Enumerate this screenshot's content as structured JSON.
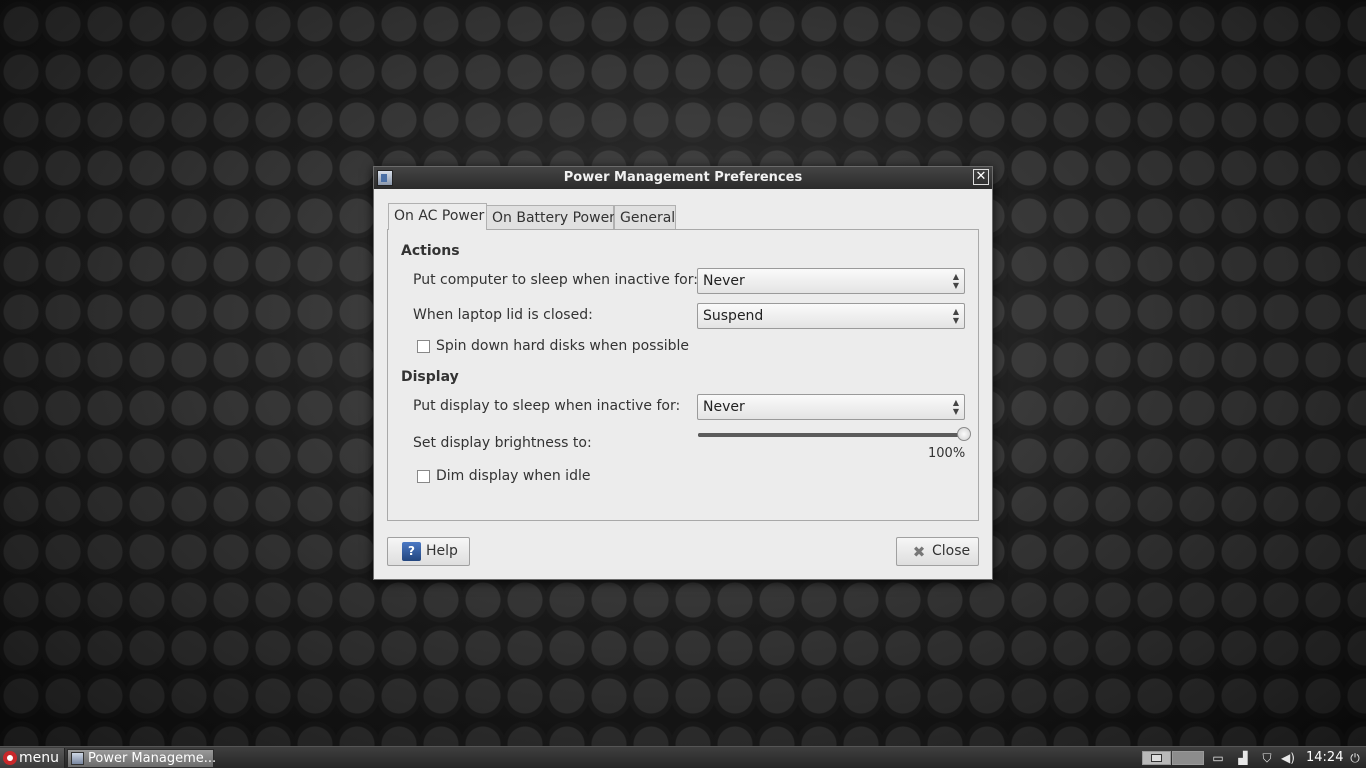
{
  "window": {
    "title": "Power Management Preferences"
  },
  "tabs": [
    {
      "label": "On AC Power",
      "active": true
    },
    {
      "label": "On Battery Power",
      "active": false
    },
    {
      "label": "General",
      "active": false
    }
  ],
  "actions": {
    "heading": "Actions",
    "sleep_label": "Put computer to sleep when inactive for:",
    "sleep_value": "Never",
    "lid_label": "When laptop lid is closed:",
    "lid_value": "Suspend",
    "spin_down_label": "Spin down hard disks when possible",
    "spin_down_checked": false
  },
  "display": {
    "heading": "Display",
    "display_sleep_label": "Put display to sleep when inactive for:",
    "display_sleep_value": "Never",
    "brightness_label": "Set display brightness to:",
    "brightness_value": "100%",
    "brightness_fraction": 1.0,
    "dim_label": "Dim display when idle",
    "dim_checked": false
  },
  "buttons": {
    "help_label": "Help",
    "close_label": "Close"
  },
  "taskbar": {
    "menu_label": "menu",
    "task_label": "Power Manageme...",
    "clock": "14:24"
  },
  "icons": {
    "title_app": "power-prefs-app-icon",
    "title_close": "close-icon",
    "help": "help-question-icon",
    "close": "close-x-icon",
    "menu": "mint-logo-icon",
    "tray": [
      "battery-icon",
      "network-signal-icon",
      "shield-update-icon",
      "volume-icon",
      "power-icon"
    ]
  }
}
